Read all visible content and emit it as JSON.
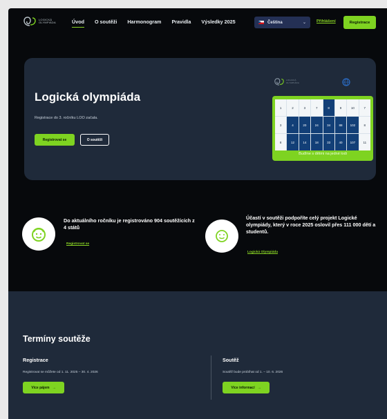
{
  "brand": {
    "logo_text_line1": "LOGICKÁ",
    "logo_text_line2": "OLYMPIÁDA",
    "accent_color": "#7ed321",
    "dark_color": "#07090c",
    "card_color": "#1f2a3a"
  },
  "nav": {
    "items": [
      {
        "label": "Úvod",
        "active": true
      },
      {
        "label": "O soutěži",
        "active": false
      },
      {
        "label": "Harmonogram",
        "active": false
      },
      {
        "label": "Pravidla",
        "active": false
      },
      {
        "label": "Výsledky 2025",
        "active": false
      }
    ],
    "language": {
      "selected": "Čeština",
      "flag_icon": "czech-flag-icon",
      "chevron_icon": "chevron-down-icon"
    },
    "login_label": "Přihlášení",
    "register_label": "Registrace"
  },
  "hero": {
    "title": "Logická olympiáda",
    "subtitle": "Registrace do 3. ročníku LOO začala.",
    "primary_button": "Registrovat se",
    "secondary_button": "O soutěži",
    "calendar": {
      "rows": [
        [
          "1",
          "2",
          "3",
          "7",
          "8",
          "9",
          "10",
          "7"
        ],
        [
          "3",
          "4",
          "20",
          "24",
          "34",
          "88",
          "102",
          "8"
        ],
        [
          "8",
          "12",
          "14",
          "18",
          "33",
          "40",
          "107",
          "11"
        ]
      ],
      "banner": "Buďme s dětmi na jedné lodi"
    }
  },
  "stats": [
    {
      "icon": "smiling-child-icon",
      "text": "Do aktuálního ročníku je registrováno 904 soutěžících z 4 států",
      "link": "Registrovat se"
    },
    {
      "icon": "smile-badge-icon",
      "text": "Účastí v soutěži podpoříte celý projekt Logické olympiády, který v roce 2025 oslovil přes 111 000 dětí a studentů.",
      "link": "Logická Olympiáda"
    }
  ],
  "schedule": {
    "title": "Termíny soutěže",
    "columns": [
      {
        "title": "Registrace",
        "text": "Registrovat se můžete od 1. 11. 2025 – 30. 4. 2026",
        "button": "Více pájem"
      },
      {
        "title": "Soutěž",
        "text": "Soutěž bude probíhat od 1. – 10. 6. 2026",
        "button": "Více informací"
      }
    ],
    "button_arrow": "→"
  }
}
